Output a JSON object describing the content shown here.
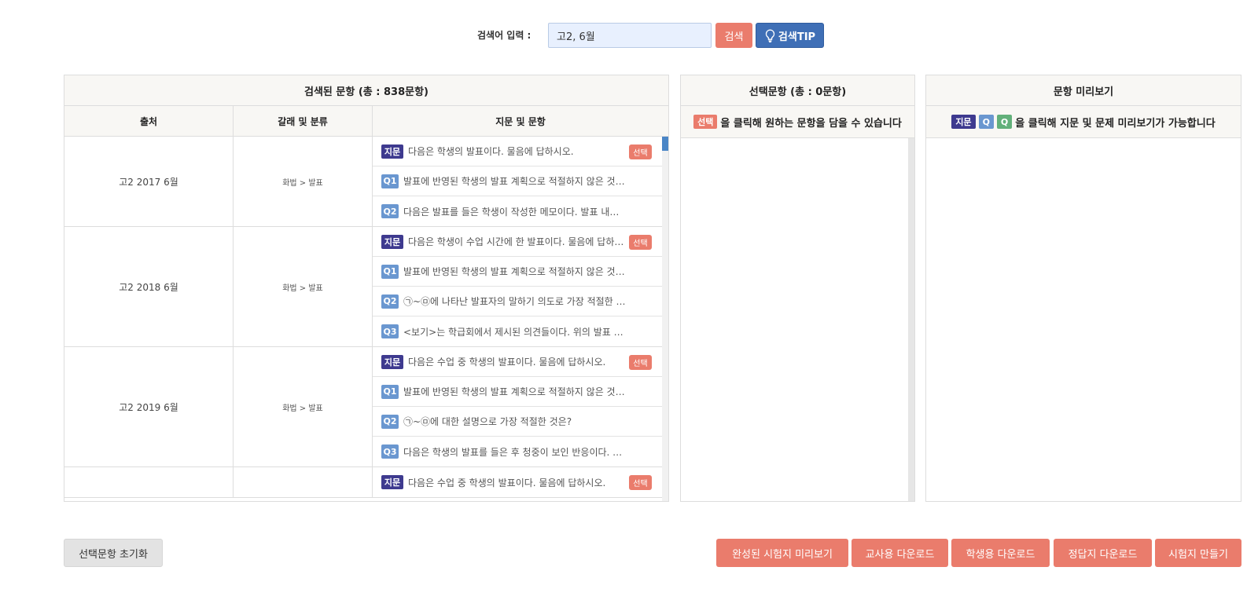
{
  "search": {
    "label": "검색어 입력 :",
    "value": "고2, 6월",
    "button": "검색",
    "tip_button": "검색TIP"
  },
  "results": {
    "title": "검색된 문항 (총 : 838문항)",
    "columns": [
      "출처",
      "갈래 및 분류",
      "지문 및 문항"
    ],
    "groups": [
      {
        "source": "고2 2017 6월",
        "category": "화법 > 발표",
        "items": [
          {
            "tag": "지문",
            "text": "다음은 학생의 발표이다. 물음에 답하시오.",
            "select": "선택"
          },
          {
            "tag": "Q1",
            "text": "발표에 반영된 학생의 발표 계획으로 적절하지 않은 것…"
          },
          {
            "tag": "Q2",
            "text": "다음은 발표를 들은 학생이 작성한 메모이다. 발표 내용…"
          }
        ]
      },
      {
        "source": "고2 2018 6월",
        "category": "화법 > 발표",
        "items": [
          {
            "tag": "지문",
            "text": "다음은 학생이 수업 시간에 한 발표이다. 물음에 답하시…",
            "select": "선택"
          },
          {
            "tag": "Q1",
            "text": "발표에 반영된 학생의 발표 계획으로 적절하지 않은 것…"
          },
          {
            "tag": "Q2",
            "text": "㉠~㉤에 나타난 발표자의 말하기 의도로 가장 적절한 …"
          },
          {
            "tag": "Q3",
            "text": "<보기>는 학급회에서 제시된 의견들이다. 위의 발표 내…"
          }
        ]
      },
      {
        "source": "고2 2019 6월",
        "category": "화법 > 발표",
        "items": [
          {
            "tag": "지문",
            "text": "다음은 수업 중 학생의 발표이다. 물음에 답하시오.",
            "select": "선택"
          },
          {
            "tag": "Q1",
            "text": "발표에 반영된 학생의 발표 계획으로 적절하지 않은 것…"
          },
          {
            "tag": "Q2",
            "text": "㉠~㉤에 대한 설명으로 가장 적절한 것은?"
          },
          {
            "tag": "Q3",
            "text": "다음은 학생의 발표를 들은 후 청중이 보인 반응이다. …"
          }
        ]
      },
      {
        "source": "",
        "category": "",
        "items": [
          {
            "tag": "지문",
            "text": "다음은 수업 중 학생의 발표이다. 물음에 답하시오.",
            "select": "선택"
          }
        ]
      }
    ]
  },
  "selected": {
    "title": "선택문항 (총 : 0문항)",
    "hint_tag": "선택",
    "hint_text": "을 클릭해 원하는 문항을 담을 수 있습니다"
  },
  "preview": {
    "title": "문항 미리보기",
    "hint_tags": [
      "지문",
      "Q",
      "Q"
    ],
    "hint_text": "을 클릭해 지문 및 문제 미리보기가 가능합니다"
  },
  "buttons": {
    "reset": "선택문항 초기화",
    "preview": "완성된 시험지 미리보기",
    "teacher": "교사용 다운로드",
    "student": "학생용 다운로드",
    "answer": "정답지 다운로드",
    "make": "시험지 만들기"
  },
  "colors": {
    "accent": "#ea7c6c",
    "tip": "#3f6fb6",
    "passage_tag": "#3e3a8f",
    "question_tag": "#6a97d0"
  },
  "icons": {
    "tip": "lightbulb-icon"
  }
}
